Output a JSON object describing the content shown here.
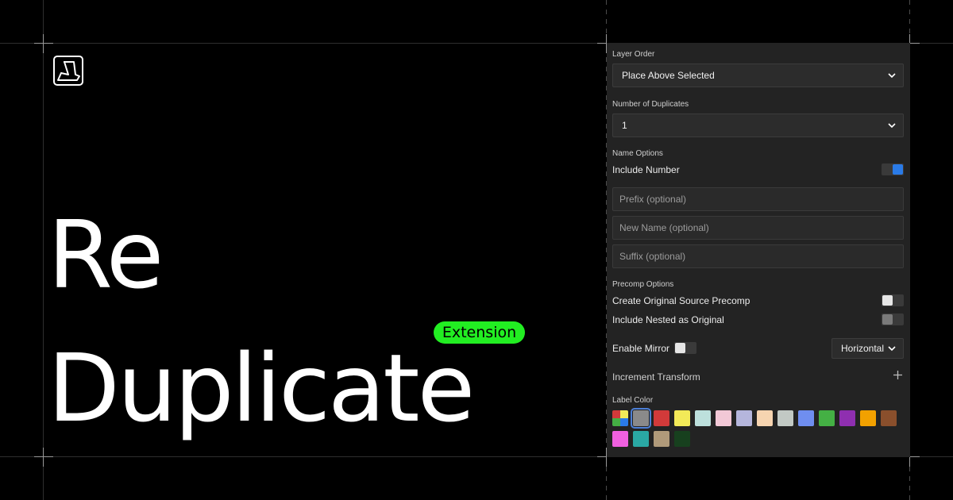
{
  "hero": {
    "line1": "Re",
    "line2": "Duplicate",
    "badge": "Extension"
  },
  "panel": {
    "layer_order": {
      "label": "Layer Order",
      "value": "Place Above Selected"
    },
    "duplicates": {
      "label": "Number of Duplicates",
      "value": "1"
    },
    "name_options": {
      "label": "Name Options",
      "include_number": {
        "label": "Include Number",
        "on": true
      },
      "prefix_placeholder": "Prefix (optional)",
      "new_name_placeholder": "New Name (optional)",
      "suffix_placeholder": "Suffix (optional)"
    },
    "precomp_options": {
      "label": "Precomp Options",
      "create_original": {
        "label": "Create Original Source Precomp",
        "on": false
      },
      "include_nested": {
        "label": "Include Nested as Original",
        "on": false
      }
    },
    "mirror": {
      "label": "Enable Mirror",
      "on": false,
      "direction": "Horizontal"
    },
    "increment_transform": {
      "label": "Increment Transform"
    },
    "label_color": {
      "label": "Label Color",
      "selected": 1,
      "colors": [
        "multi",
        "#8a8a8a",
        "#d23a3a",
        "#f2ea58",
        "#bde0dc",
        "#f2c8d6",
        "#b5b6dc",
        "#f6d4b0",
        "#c2c9c4",
        "#6f8ef0",
        "#44b044",
        "#8f2fb0",
        "#f2a100",
        "#8a4f2c",
        "#f060e0",
        "#2aa8a4",
        "#b09a7a",
        "#17401e"
      ]
    }
  },
  "colors": {
    "accent_green": "#22ee22",
    "toggle_on": "#2a7be8"
  }
}
